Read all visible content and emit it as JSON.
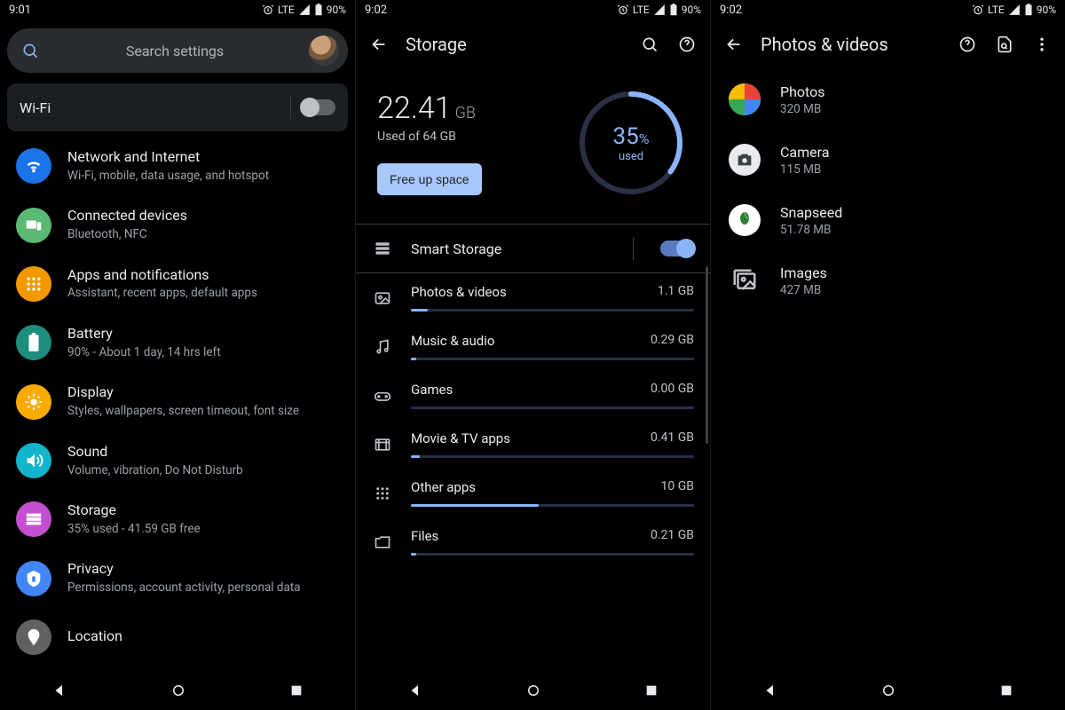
{
  "status": {
    "time1": "9:01",
    "time2": "9:02",
    "time3": "9:02",
    "net": "LTE",
    "battery": "90%"
  },
  "settings": {
    "search_placeholder": "Search settings",
    "wifi_label": "Wi-Fi",
    "items": [
      {
        "title": "Network and Internet",
        "sub": "Wi-Fi, mobile, data usage, and hotspot",
        "icon": "wifi",
        "color": "#1a73e8"
      },
      {
        "title": "Connected devices",
        "sub": "Bluetooth, NFC",
        "icon": "devices",
        "color": "#5bb974"
      },
      {
        "title": "Apps and notifications",
        "sub": "Assistant, recent apps, default apps",
        "icon": "apps",
        "color": "#f29900"
      },
      {
        "title": "Battery",
        "sub": "90% - About 1 day, 14 hrs left",
        "icon": "battery",
        "color": "#1e8e7e"
      },
      {
        "title": "Display",
        "sub": "Styles, wallpapers, screen timeout, font size",
        "icon": "display",
        "color": "#f9ab00"
      },
      {
        "title": "Sound",
        "sub": "Volume, vibration, Do Not Disturb",
        "icon": "sound",
        "color": "#12b5cb"
      },
      {
        "title": "Storage",
        "sub": "35% used - 41.59 GB free",
        "icon": "storage",
        "color": "#c44fd0"
      },
      {
        "title": "Privacy",
        "sub": "Permissions, account activity, personal data",
        "icon": "privacy",
        "color": "#4285f4"
      },
      {
        "title": "Location",
        "sub": "",
        "icon": "location",
        "color": "#616161"
      }
    ]
  },
  "storage": {
    "title": "Storage",
    "used_value": "22.41",
    "used_unit": "GB",
    "used_of": "Used of 64 GB",
    "free_up": "Free up space",
    "percent": "35",
    "percent_sym": "%",
    "used_label": "used",
    "smart_label": "Smart Storage",
    "categories": [
      {
        "name": "Photos & videos",
        "size": "1.1 GB",
        "pct": 6
      },
      {
        "name": "Music & audio",
        "size": "0.29 GB",
        "pct": 2
      },
      {
        "name": "Games",
        "size": "0.00 GB",
        "pct": 0
      },
      {
        "name": "Movie & TV apps",
        "size": "0.41 GB",
        "pct": 3
      },
      {
        "name": "Other apps",
        "size": "10 GB",
        "pct": 45
      },
      {
        "name": "Files",
        "size": "0.21 GB",
        "pct": 2
      }
    ]
  },
  "photos": {
    "title": "Photos & videos",
    "items": [
      {
        "title": "Photos",
        "sub": "320 MB",
        "icon": "gphotos"
      },
      {
        "title": "Camera",
        "sub": "115 MB",
        "icon": "camera"
      },
      {
        "title": "Snapseed",
        "sub": "51.78 MB",
        "icon": "snapseed"
      },
      {
        "title": "Images",
        "sub": "427 MB",
        "icon": "images"
      }
    ]
  }
}
